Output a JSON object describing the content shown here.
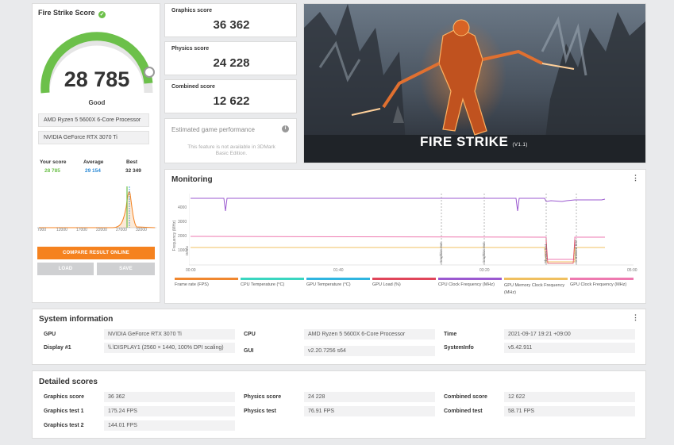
{
  "fire_strike": {
    "title": "Fire Strike Score",
    "score": "28 785",
    "rating": "Good",
    "cpu": "AMD Ryzen 5 5600X 6-Core Processor",
    "gpu": "NVIDIA GeForce RTX 3070 Ti",
    "your_score_label": "Your score",
    "your_score": "28 785",
    "average_label": "Average",
    "average": "29 154",
    "best_label": "Best",
    "best": "32 349",
    "dist_ticks": [
      "7000",
      "12000",
      "17000",
      "22000",
      "27000",
      "32000"
    ],
    "compare_button": "COMPARE RESULT ONLINE",
    "load_button": "LOAD",
    "save_button": "SAVE",
    "colors": {
      "accent_green": "#6cc04a",
      "orange": "#f5821f",
      "gauge_gray": "#e5e5e5"
    }
  },
  "scores": {
    "graphics_label": "Graphics score",
    "graphics": "36 362",
    "physics_label": "Physics score",
    "physics": "24 228",
    "combined_label": "Combined score",
    "combined": "12 622"
  },
  "game_perf": {
    "title": "Estimated game performance",
    "text_line1": "This feature is not available in 3DMark",
    "text_line2": "Basic Edition."
  },
  "hero": {
    "title": "FIRE STRIKE",
    "version": "(V1.1)"
  },
  "monitoring": {
    "title": "Monitoring",
    "y_axis_label": "Frequency (MHz)",
    "y_ticks": [
      "4000",
      "3000",
      "2000",
      "1000"
    ],
    "x_ticks": [
      "00:00",
      "01:40",
      "03:20",
      "05:00"
    ],
    "markers": [
      "Demo",
      "Graphics test",
      "Graphics test",
      "Physics test",
      "Combined test"
    ],
    "legend": [
      {
        "label": "Frame rate (FPS)",
        "color": "#f0872f"
      },
      {
        "label": "CPU Temperature (°C)",
        "color": "#3ad6c0"
      },
      {
        "label": "GPU Temperature (°C)",
        "color": "#2fb5e0"
      },
      {
        "label": "GPU Load (%)",
        "color": "#e0455a"
      },
      {
        "label": "CPU Clock Frequency (MHz)",
        "color": "#9b59d0"
      },
      {
        "label": "GPU Memory Clock Frequency (MHz)",
        "color": "#f0c060"
      },
      {
        "label": "GPU Clock Frequency (MHz)",
        "color": "#ee7ab0"
      }
    ]
  },
  "system_info": {
    "title": "System information",
    "gpu_label": "GPU",
    "gpu": "NVIDIA GeForce RTX 3070 Ti",
    "display_label": "Display #1",
    "display": "\\\\.\\DISPLAY1 (2560 × 1440, 100% DPI scaling)",
    "cpu_label": "CPU",
    "cpu": "AMD Ryzen 5 5600X 6-Core Processor",
    "gui_label": "GUI",
    "gui": "v2.20.7256 s64",
    "time_label": "Time",
    "time": "2021-09-17 19:21 +09:00",
    "sysinfo_label": "SystemInfo",
    "sysinfo": "v5.42.911"
  },
  "detailed": {
    "title": "Detailed scores",
    "graphics_score_label": "Graphics score",
    "graphics_score": "36 362",
    "graphics_test1_label": "Graphics test 1",
    "graphics_test1": "175.24 FPS",
    "graphics_test2_label": "Graphics test 2",
    "graphics_test2": "144.01 FPS",
    "physics_score_label": "Physics score",
    "physics_score": "24 228",
    "physics_test_label": "Physics test",
    "physics_test": "76.91 FPS",
    "combined_score_label": "Combined score",
    "combined_score": "12 622",
    "combined_test_label": "Combined test",
    "combined_test": "58.71 FPS"
  }
}
